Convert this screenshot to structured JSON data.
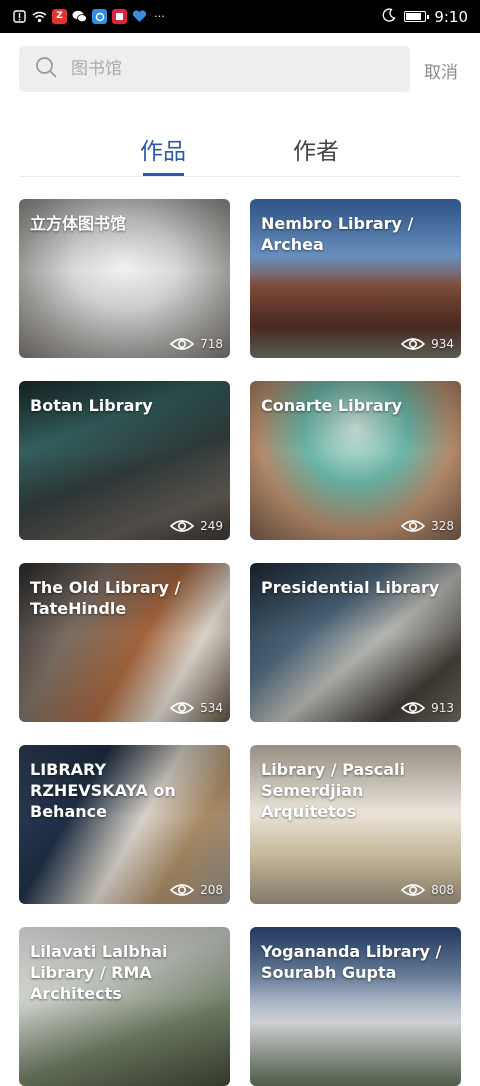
{
  "status_bar": {
    "time": "9:10",
    "icons": [
      "alert-icon",
      "wifi-icon",
      "app-z-icon",
      "wechat-icon",
      "browser-icon",
      "app-red-icon",
      "heart-icon",
      "more-dots-icon"
    ],
    "notification_dots": "···",
    "app_z_label": "Z"
  },
  "search": {
    "placeholder": "图书馆",
    "cancel_label": "取消"
  },
  "tabs": [
    {
      "label": "作品",
      "active": true
    },
    {
      "label": "作者",
      "active": false
    }
  ],
  "cards": [
    {
      "title": "立方体图书馆",
      "views": "718"
    },
    {
      "title": "Nembro Library / Archea",
      "views": "934"
    },
    {
      "title": "Botan Library",
      "views": "249"
    },
    {
      "title": "Conarte Library",
      "views": "328"
    },
    {
      "title": "The Old Library / TateHindle",
      "views": "534"
    },
    {
      "title": "Presidential Library",
      "views": "913"
    },
    {
      "title": "LIBRARY RZHEVSKAYA on Behance",
      "views": "208"
    },
    {
      "title": "Library / Pascali Semerdjian Arquitetos",
      "views": "808"
    },
    {
      "title": "Lilavati Lalbhai Library / RMA Architects",
      "views": ""
    },
    {
      "title": "Yogananda Library / Sourabh Gupta",
      "views": ""
    }
  ],
  "colors": {
    "accent": "#2e58a6",
    "search_bg": "#eeeeee",
    "cancel_text": "#8a8a8a"
  }
}
